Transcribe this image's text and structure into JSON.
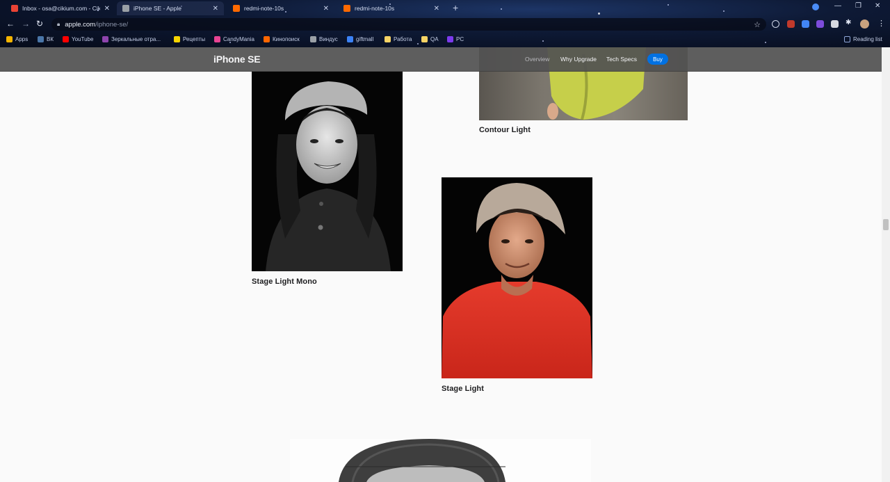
{
  "browser": {
    "tabs": [
      {
        "title": "Inbox - osa@cikium.com - Ciklu",
        "favicon_color": "#ea4335"
      },
      {
        "title": "iPhone SE - Apple",
        "favicon_color": "#9aa0a6"
      },
      {
        "title": "redmi-note-10s",
        "favicon_color": "#ff6900"
      },
      {
        "title": "redmi-note-10s",
        "favicon_color": "#ff6900"
      }
    ],
    "url_host": "apple.com",
    "url_path": "/iphone-se/",
    "bookmarks": [
      {
        "label": "Apps",
        "color": "#f4b400"
      },
      {
        "label": "ВК",
        "color": "#4a76a8"
      },
      {
        "label": "YouTube",
        "color": "#ff0000"
      },
      {
        "label": "Зеркальные отра...",
        "color": "#8e44ad"
      },
      {
        "label": "Рецепты",
        "color": "#f6d400"
      },
      {
        "label": "CandyMania",
        "color": "#e84393"
      },
      {
        "label": "Кинопоиск",
        "color": "#ff6600"
      },
      {
        "label": "Виндус",
        "color": "#9aa0a6"
      },
      {
        "label": "giftmall",
        "color": "#3b82f6"
      },
      {
        "label": "Работа",
        "color": "#f6d365"
      },
      {
        "label": "QA",
        "color": "#f6d365"
      },
      {
        "label": "PC",
        "color": "#7c3aed"
      }
    ],
    "reading_list": "Reading list"
  },
  "localnav": {
    "product": "iPhone SE",
    "links": [
      "Overview",
      "Why Upgrade",
      "Tech Specs"
    ],
    "buy": "Buy"
  },
  "photos": {
    "contour": {
      "caption": "Contour Light"
    },
    "stage_mono": {
      "caption": "Stage Light Mono"
    },
    "stage": {
      "caption": "Stage Light"
    }
  }
}
